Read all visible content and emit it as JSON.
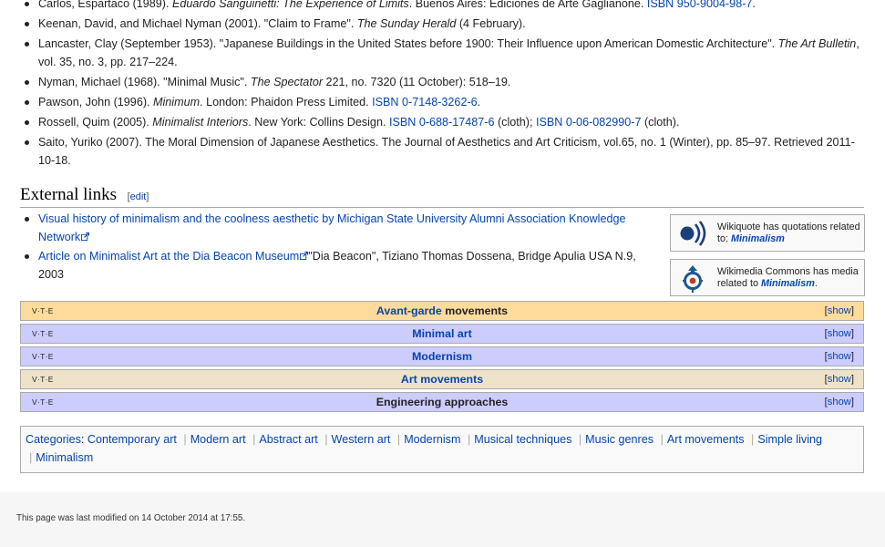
{
  "references": [
    {
      "parts": [
        {
          "t": "Carlos, Espartaco (1989). "
        },
        {
          "t": "Eduardo Sanguinetti: The Experience of Limits",
          "i": 1
        },
        {
          "t": ". Buenos Aires: Ediciones de Arte Gaglianone. "
        },
        {
          "t": "ISBN 950-9004-98-7",
          "link": 1
        },
        {
          "t": "."
        }
      ]
    },
    {
      "parts": [
        {
          "t": "Keenan, David, and Michael Nyman (2001). \"Claim to Frame\". "
        },
        {
          "t": "The Sunday Herald",
          "i": 1
        },
        {
          "t": " (4 February)."
        }
      ]
    },
    {
      "parts": [
        {
          "t": "Lancaster, Clay (September 1953). \"Japanese Buildings in the United States before 1900: Their Influence upon American Domestic Architecture\". "
        },
        {
          "t": "The Art Bulletin",
          "i": 1
        },
        {
          "t": ", vol. 35, no. 3, pp. 217–224."
        }
      ]
    },
    {
      "parts": [
        {
          "t": "Nyman, Michael (1968). \"Minimal Music\". "
        },
        {
          "t": "The Spectator",
          "i": 1
        },
        {
          "t": " 221, no. 7320 (11 October): 518–19."
        }
      ]
    },
    {
      "parts": [
        {
          "t": "Pawson, John (1996). "
        },
        {
          "t": "Minimum",
          "i": 1
        },
        {
          "t": ". London: Phaidon Press Limited. "
        },
        {
          "t": "ISBN 0-7148-3262-6",
          "link": 1
        },
        {
          "t": "."
        }
      ]
    },
    {
      "parts": [
        {
          "t": "Rossell, Quim (2005). "
        },
        {
          "t": "Minimalist Interiors",
          "i": 1
        },
        {
          "t": ". New York: Collins Design. "
        },
        {
          "t": "ISBN 0-688-17487-6",
          "link": 1
        },
        {
          "t": " (cloth); "
        },
        {
          "t": "ISBN 0-06-082990-7",
          "link": 1
        },
        {
          "t": " (cloth)."
        }
      ]
    },
    {
      "parts": [
        {
          "t": "Saito, Yuriko (2007). The Moral Dimension of Japanese Aesthetics. The Journal of Aesthetics and Art Criticism, vol.65, no. 1 (Winter), pp. 85–97. Retrieved 2011-10-18."
        }
      ]
    }
  ],
  "external_links": {
    "heading": "External links",
    "edit_label": "[edit]",
    "items": [
      {
        "link": "Visual history of minimalism and the coolness aesthetic by Michigan State University Alumni Association Knowledge Network",
        "after": ""
      },
      {
        "link": "Article on Minimalist Art at the Dia Beacon Museum",
        "after": "\"Dia Beacon\", Tiziano Thomas Dossena, Bridge Apulia USA N.9, 2003"
      }
    ]
  },
  "sister": {
    "wikiquote": {
      "text": "Wikiquote has quotations related to: ",
      "link": "Minimalism",
      "icon": "wikiquote-icon"
    },
    "commons": {
      "text": "Wikimedia Commons has media related to ",
      "link": "Minimalism",
      "suffix": ".",
      "icon": "commons-icon"
    }
  },
  "navboxes": [
    {
      "vte": "v·t·e",
      "link": "Avant-garde",
      "rest": " movements",
      "show": "show",
      "bg": "#fddb9b"
    },
    {
      "vte": "v·t·e",
      "link": "Minimal art",
      "rest": "",
      "show": "show",
      "bg": "#ccccff"
    },
    {
      "vte": "v·t·e",
      "link": "Modernism",
      "rest": "",
      "show": "show",
      "bg": "#ccccff"
    },
    {
      "vte": "v·t·e",
      "link": "Art movements",
      "rest": "",
      "show": "show",
      "bg": "#eee2c8"
    },
    {
      "vte": "v·t·e",
      "link": "",
      "rest": "Engineering approaches",
      "show": "show",
      "bg": "#ccccff"
    }
  ],
  "categories": {
    "label": "Categories",
    "items": [
      "Contemporary art",
      "Modern art",
      "Abstract art",
      "Western art",
      "Modernism",
      "Musical techniques",
      "Music genres",
      "Art movements",
      "Simple living",
      "Minimalism"
    ]
  },
  "footer": {
    "last_modified": "This page was last modified on 14 October 2014 at 17:55."
  }
}
